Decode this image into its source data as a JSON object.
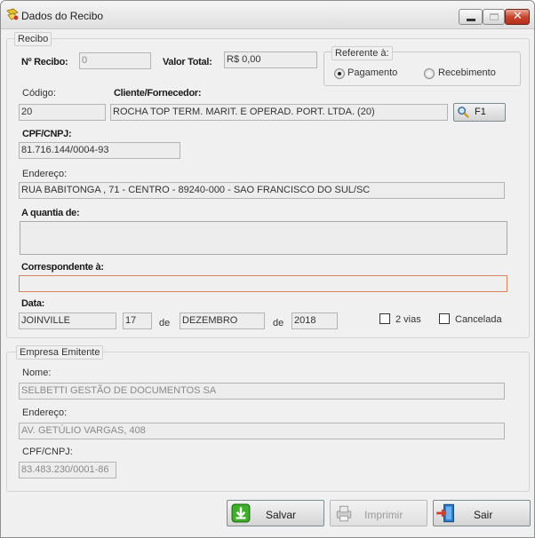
{
  "window": {
    "title": "Dados do Recibo"
  },
  "recibo": {
    "legend": "Recibo",
    "numero_label": "Nº Recibo:",
    "numero_value": "0",
    "valor_total_label": "Valor Total:",
    "valor_total_value": "R$ 0,00",
    "referente": {
      "legend": "Referente à:",
      "options": [
        {
          "label": "Pagamento",
          "selected": true
        },
        {
          "label": "Recebimento",
          "selected": false
        }
      ]
    },
    "codigo_label": "Código:",
    "codigo_value": "20",
    "cliente_label": "Cliente/Fornecedor:",
    "cliente_value": "ROCHA TOP TERM. MARIT. E OPERAD. PORT. LTDA. (20)",
    "search_button_label": "F1",
    "cpf_label": "CPF/CNPJ:",
    "cpf_value": "81.716.144/0004-93",
    "endereco_label": "Endereço:",
    "endereco_value": "RUA BABITONGA , 71 - CENTRO - 89240-000 - SAO FRANCISCO DO SUL/SC",
    "quantia_label": "A quantia de:",
    "quantia_value": "",
    "correspondente_label": "Correspondente à:",
    "correspondente_value": "",
    "data_label": "Data:",
    "cidade_value": "JOINVILLE",
    "dia_value": "17",
    "de1": "de",
    "mes_value": "DEZEMBRO",
    "de2": "de",
    "ano_value": "2018",
    "duas_vias_label": "2 vias",
    "cancelada_label": "Cancelada"
  },
  "empresa": {
    "legend": "Empresa Emitente",
    "nome_label": "Nome:",
    "nome_value": "SELBETTI GESTÃO DE DOCUMENTOS SA",
    "endereco_label": "Endereço:",
    "endereco_value": "AV. GETÚLIO VARGAS, 408",
    "cpf_label": "CPF/CNPJ:",
    "cpf_value": "83.483.230/0001-86"
  },
  "actions": {
    "salvar": "Salvar",
    "imprimir": "Imprimir",
    "sair": "Sair"
  },
  "colors": {
    "salvar_icon": "#3fae2a",
    "sair_icon": "#2f7fd0",
    "focus_border": "#d9825a"
  }
}
